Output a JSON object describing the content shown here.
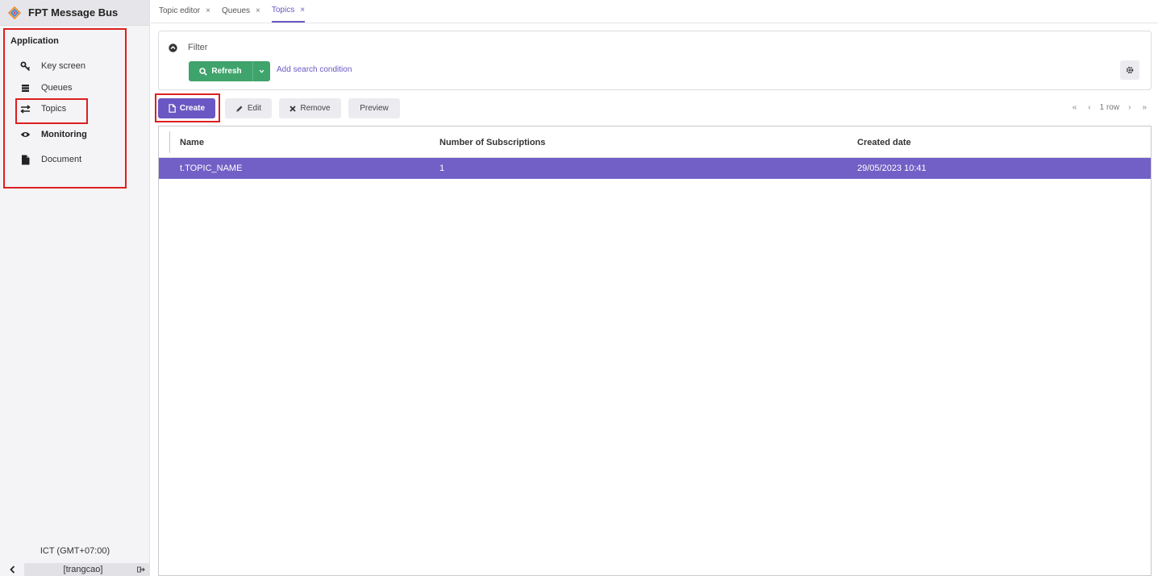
{
  "app": {
    "title": "FPT Message Bus"
  },
  "sidebar": {
    "header": "Application",
    "items": [
      {
        "label": "Key screen",
        "icon": "key-icon"
      },
      {
        "label": "Queues",
        "icon": "queue-icon"
      },
      {
        "label": "Topics",
        "icon": "exchange-icon"
      },
      {
        "label": "Monitoring",
        "icon": "eye-icon"
      },
      {
        "label": "Document",
        "icon": "document-icon"
      }
    ],
    "timezone": "ICT (GMT+07:00)",
    "user": "[trangcao]"
  },
  "tabs": [
    {
      "label": "Topic editor",
      "close": "×"
    },
    {
      "label": "Queues",
      "close": "×"
    },
    {
      "label": "Topics",
      "close": "×"
    }
  ],
  "filter": {
    "label": "Filter",
    "refresh_label": "Refresh",
    "add_condition": "Add search condition"
  },
  "toolbar": {
    "create": "Create",
    "edit": "Edit",
    "remove": "Remove",
    "preview": "Preview"
  },
  "pager": {
    "first": "«",
    "prev": "‹",
    "count": "1 row",
    "next": "›",
    "last": "»"
  },
  "grid": {
    "columns": [
      "Name",
      "Number of Subscriptions",
      "Created date"
    ],
    "rows": [
      {
        "name": "t.TOPIC_NAME",
        "subscriptions": "1",
        "created": "29/05/2023 10:41"
      }
    ]
  },
  "colors": {
    "accent": "#6b57c3",
    "selected_row": "#7260c6",
    "refresh": "#3fa36c",
    "highlight": "#dd1f1f"
  }
}
